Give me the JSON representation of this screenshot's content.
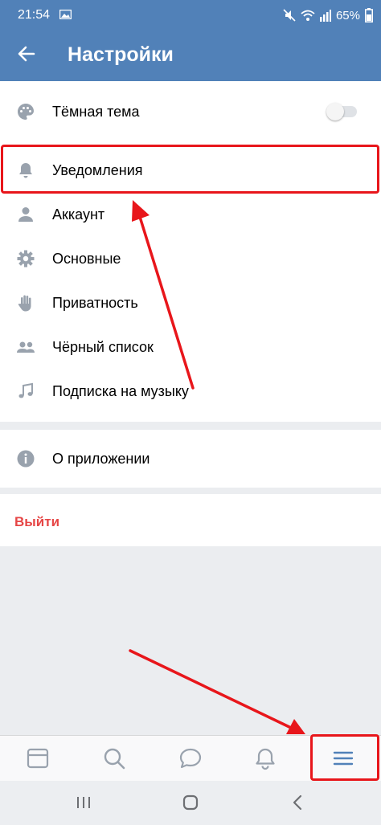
{
  "status": {
    "time": "21:54",
    "battery": "65%"
  },
  "header": {
    "title": "Настройки"
  },
  "settings": [
    {
      "label": "Тёмная тема",
      "icon": "palette-icon"
    },
    {
      "label": "Уведомления",
      "icon": "bell-icon"
    },
    {
      "label": "Аккаунт",
      "icon": "person-icon"
    },
    {
      "label": "Основные",
      "icon": "gear-icon"
    },
    {
      "label": "Приватность",
      "icon": "hand-icon"
    },
    {
      "label": "Чёрный список",
      "icon": "people-icon"
    },
    {
      "label": "Подписка на музыку",
      "icon": "music-note-icon"
    }
  ],
  "dark_theme_enabled": false,
  "about": {
    "label": "О приложении",
    "icon": "info-icon"
  },
  "logout": {
    "label": "Выйти"
  },
  "colors": {
    "primary": "#5181b8",
    "danger": "#e64646",
    "annotation": "#e8161b"
  },
  "tabbar": [
    "news-icon",
    "search-icon",
    "messages-icon",
    "notifications-icon",
    "menu-icon"
  ]
}
